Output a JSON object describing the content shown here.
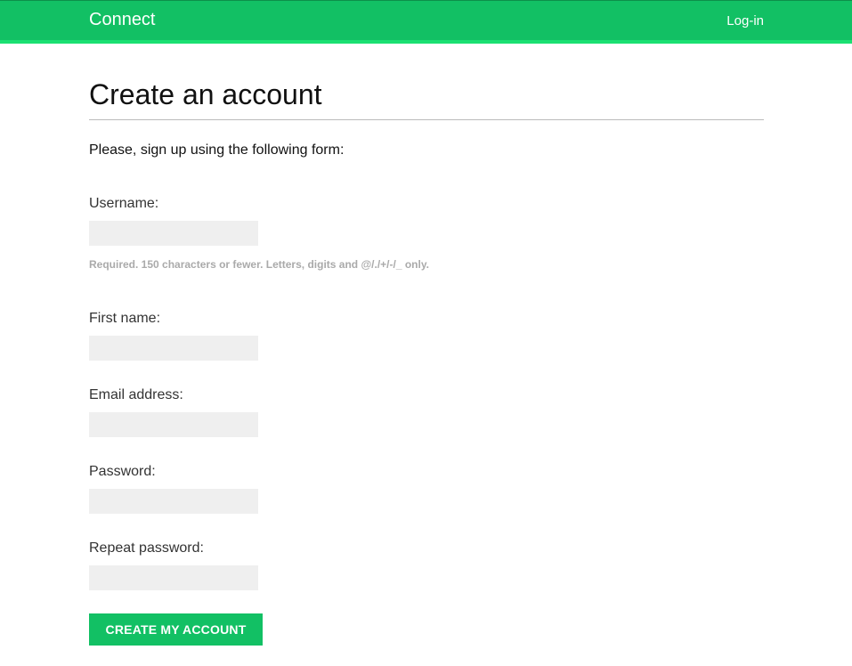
{
  "header": {
    "brand": "Connect",
    "login_label": "Log-in",
    "accent_color": "#12c064"
  },
  "main": {
    "title": "Create an account",
    "intro": "Please, sign up using the following form:"
  },
  "form": {
    "username": {
      "label": "Username:",
      "value": "",
      "help": "Required. 150 characters or fewer. Letters, digits and @/./+/-/_ only."
    },
    "first_name": {
      "label": "First name:",
      "value": ""
    },
    "email": {
      "label": "Email address:",
      "value": ""
    },
    "password": {
      "label": "Password:",
      "value": ""
    },
    "repeat_password": {
      "label": "Repeat password:",
      "value": ""
    },
    "submit_label": "CREATE MY ACCOUNT"
  }
}
